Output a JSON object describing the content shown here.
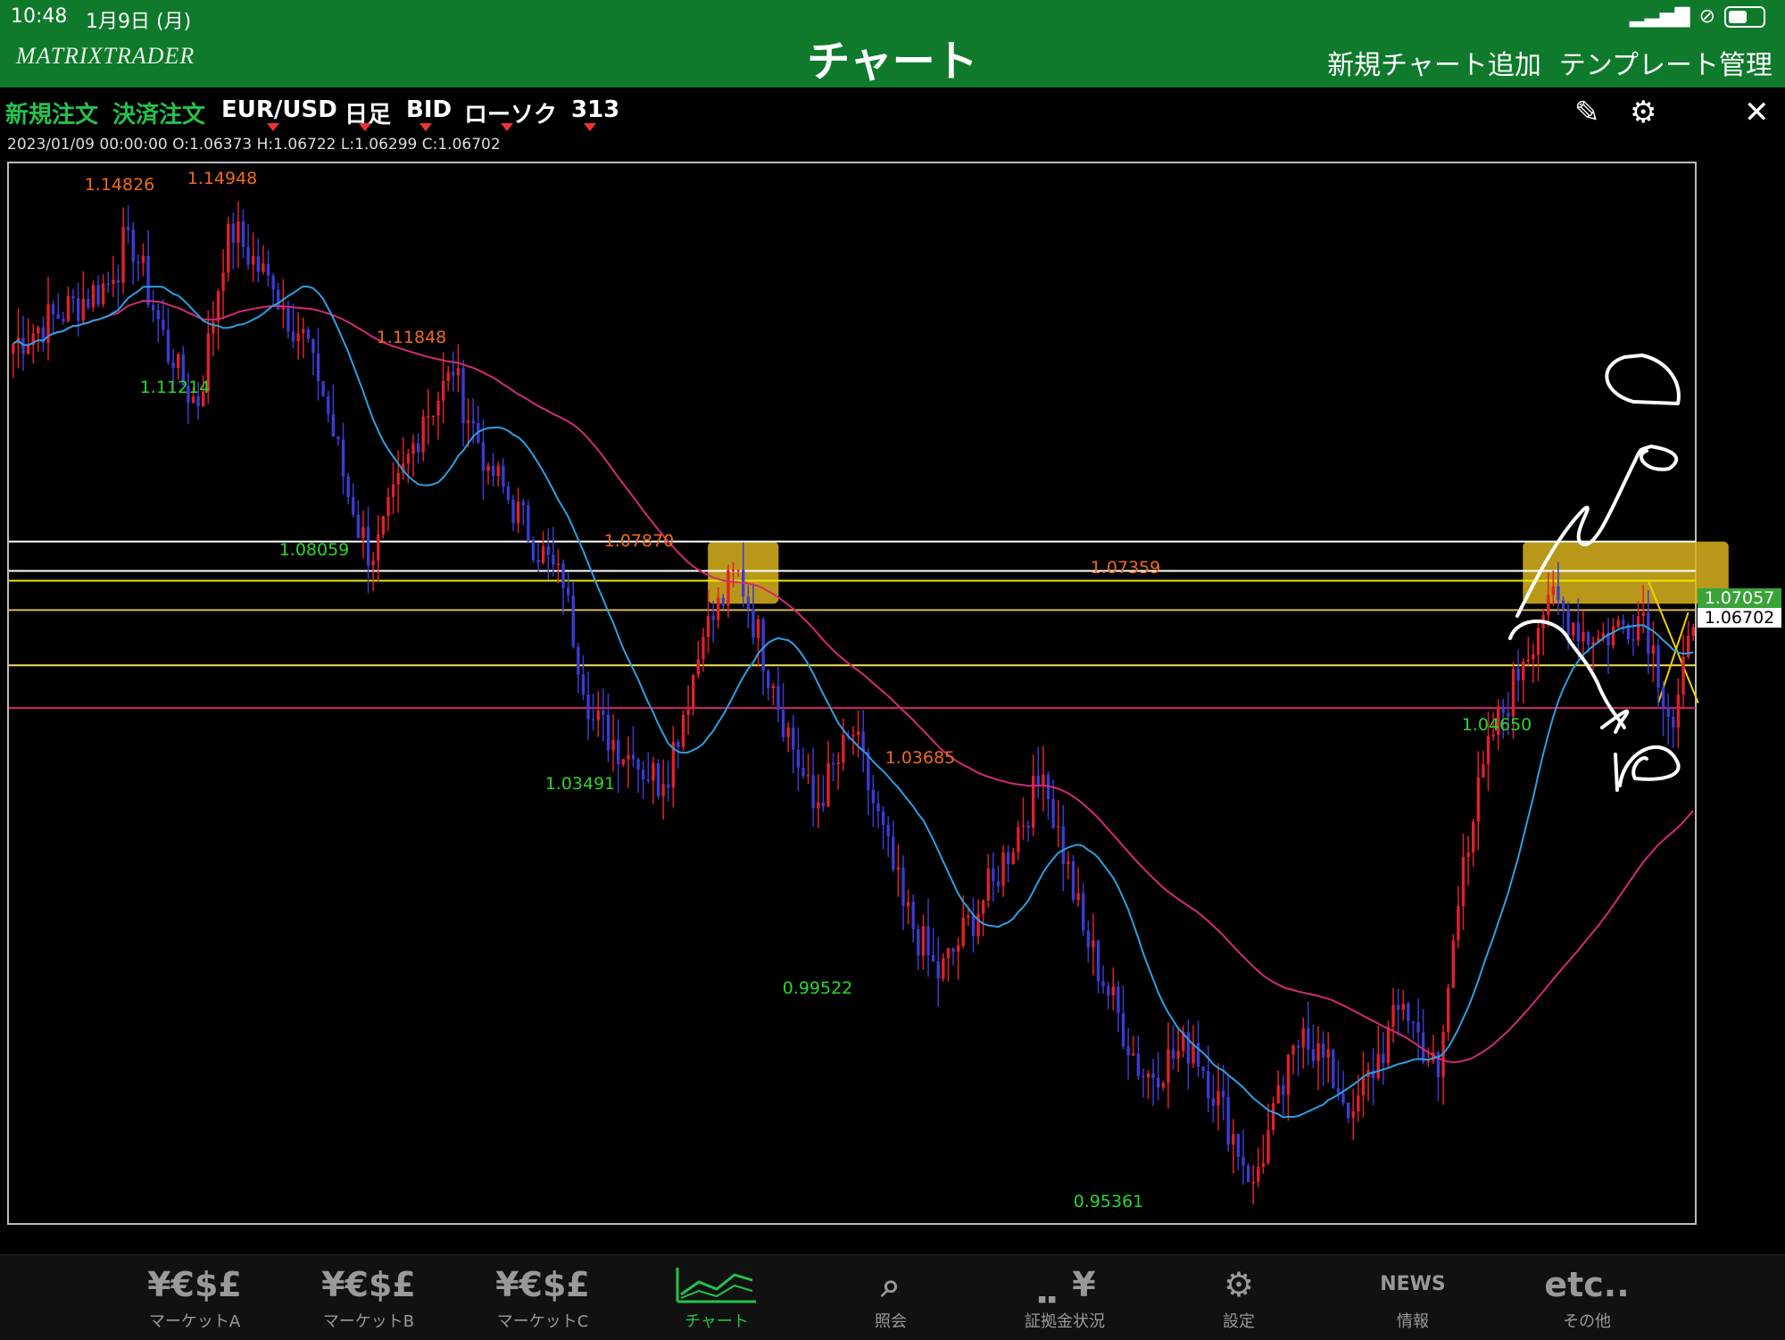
{
  "status": {
    "time": "10:48",
    "date": "1月9日 (月)"
  },
  "nav": {
    "logo": "MATRIXTRADER",
    "title": "チャート",
    "add_chart": "新規チャート追加",
    "template": "テンプレート管理"
  },
  "toolbar": {
    "new_order": "新規注文",
    "close_order": "決済注文",
    "pair": "EUR/USD",
    "period": "日足",
    "price_type": "BID",
    "chart_style": "ローソク",
    "count": "313"
  },
  "ohlc": "2023/01/09 00:00:00   O:1.06373  H:1.06722  L:1.06299  C:1.06702",
  "price_tags": {
    "current": "1.07057",
    "close": "1.06702"
  },
  "chart_data": {
    "type": "candlestick",
    "symbol": "EUR/USD",
    "timeframe": "日足",
    "ylim": [
      0.945,
      1.162
    ],
    "peak_labels": [
      "1.14826",
      "1.14948",
      "1.11848",
      "1.07870",
      "1.03685",
      "1.07359"
    ],
    "trough_labels": [
      "1.11214",
      "1.08059",
      "1.03491",
      "0.99522",
      "0.95361",
      "1.04650"
    ],
    "key_points": [
      {
        "i": 0,
        "v": 1.125
      },
      {
        "i": 20,
        "v": 1.138
      },
      {
        "i": 23,
        "v": 1.14826
      },
      {
        "i": 32,
        "v": 1.12
      },
      {
        "i": 37,
        "v": 1.11214
      },
      {
        "i": 43,
        "v": 1.14948
      },
      {
        "i": 52,
        "v": 1.136
      },
      {
        "i": 60,
        "v": 1.123
      },
      {
        "i": 68,
        "v": 1.09
      },
      {
        "i": 72,
        "v": 1.08059
      },
      {
        "i": 82,
        "v": 1.11
      },
      {
        "i": 88,
        "v": 1.11848
      },
      {
        "i": 95,
        "v": 1.1
      },
      {
        "i": 110,
        "v": 1.075
      },
      {
        "i": 116,
        "v": 1.048
      },
      {
        "i": 124,
        "v": 1.04
      },
      {
        "i": 130,
        "v": 1.03491
      },
      {
        "i": 138,
        "v": 1.065
      },
      {
        "i": 145,
        "v": 1.0787
      },
      {
        "i": 152,
        "v": 1.055
      },
      {
        "i": 160,
        "v": 1.03
      },
      {
        "i": 168,
        "v": 1.045
      },
      {
        "i": 178,
        "v": 1.01
      },
      {
        "i": 185,
        "v": 0.99522
      },
      {
        "i": 196,
        "v": 1.015
      },
      {
        "i": 206,
        "v": 1.03685
      },
      {
        "i": 214,
        "v": 1.005
      },
      {
        "i": 226,
        "v": 0.975
      },
      {
        "i": 236,
        "v": 0.982
      },
      {
        "i": 248,
        "v": 0.95361
      },
      {
        "i": 258,
        "v": 0.985
      },
      {
        "i": 268,
        "v": 0.968
      },
      {
        "i": 278,
        "v": 0.99
      },
      {
        "i": 285,
        "v": 0.975
      },
      {
        "i": 290,
        "v": 1.02
      },
      {
        "i": 296,
        "v": 1.045
      },
      {
        "i": 302,
        "v": 1.06
      },
      {
        "i": 307,
        "v": 1.07359
      },
      {
        "i": 316,
        "v": 1.064
      },
      {
        "i": 326,
        "v": 1.07
      },
      {
        "i": 332,
        "v": 1.0465
      },
      {
        "i": 336,
        "v": 1.06702
      }
    ],
    "horizontal_lines": [
      {
        "v": 1.0845,
        "color": "#ffffff"
      },
      {
        "v": 1.0785,
        "color": "#ffffff"
      },
      {
        "v": 1.0765,
        "color": "#e6e600"
      },
      {
        "v": 1.0705,
        "color": "#d8b84a"
      },
      {
        "v": 1.0592,
        "color": "#f0e060"
      },
      {
        "v": 1.0505,
        "color": "#cc2266"
      }
    ],
    "colors": {
      "up": "#e2202a",
      "down": "#3b3bd4",
      "ma_short": "#2e9fe0",
      "ma_long": "#d22a78",
      "peak": "#f06a1a",
      "trough": "#2bd62b",
      "highlight": "#d9b21d"
    }
  },
  "tabs": [
    {
      "icon": "¥€$£",
      "label": "マーケットA"
    },
    {
      "icon": "¥€$£",
      "label": "マーケットB"
    },
    {
      "icon": "¥€$£",
      "label": "マーケットC"
    },
    {
      "icon": "",
      "label": "チャート"
    },
    {
      "icon": "",
      "label": "照会"
    },
    {
      "icon": "",
      "label": "証拠金状況"
    },
    {
      "icon": "",
      "label": "設定"
    },
    {
      "icon": "NEWS",
      "label": "情報"
    },
    {
      "icon": "etc..",
      "label": "その他"
    }
  ]
}
